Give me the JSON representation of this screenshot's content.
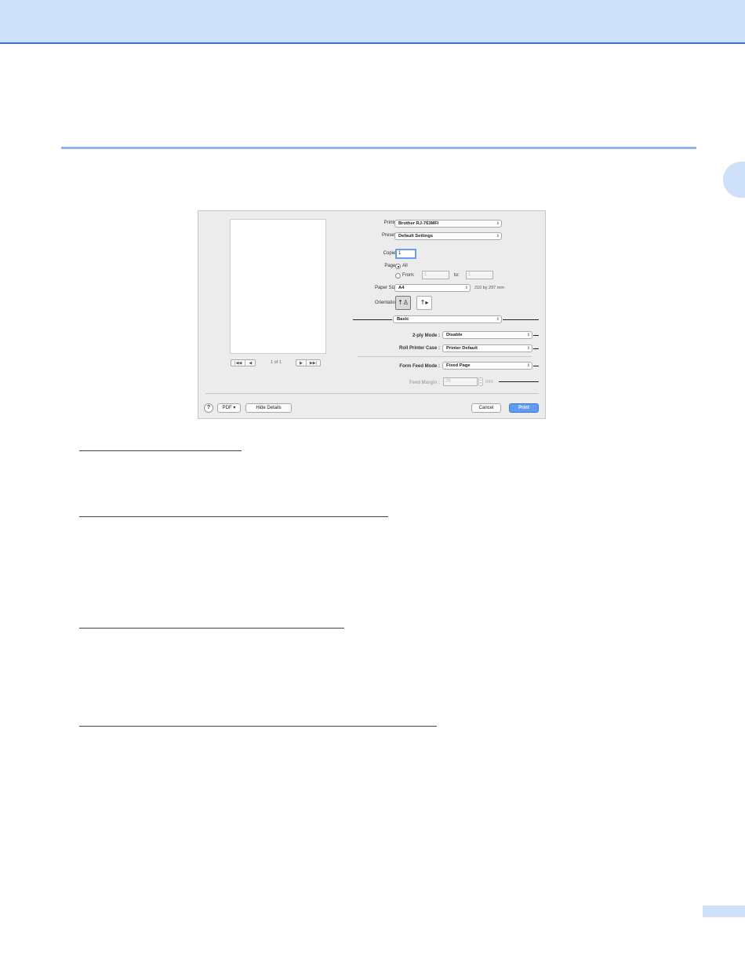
{
  "dialog": {
    "preview": {
      "page_counter": "1 of 1",
      "first_label": "|◀◀",
      "prev_label": "◀",
      "next_label": "▶",
      "last_label": "▶▶|"
    },
    "printer": {
      "label": "Printer:",
      "value": "Brother RJ-763MFi"
    },
    "presets": {
      "label": "Presets:",
      "value": "Default Settings"
    },
    "copies": {
      "label": "Copies:",
      "value": "1"
    },
    "pages": {
      "label": "Pages:",
      "all_label": "All",
      "from_label": "From:",
      "from_value": "1",
      "to_label": "to:",
      "to_value": "1",
      "selected": "All"
    },
    "paper_size": {
      "label": "Paper Size:",
      "value": "A4",
      "dimensions": "210 by 297 mm"
    },
    "orientation": {
      "label": "Orientation:",
      "selected": "portrait"
    },
    "panel_menu": {
      "value": "Basic"
    },
    "two_ply_mode": {
      "label": "2-ply Mode :",
      "value": "Disable"
    },
    "roll_printer_case": {
      "label": "Roll Printer Case :",
      "value": "Printer Default"
    },
    "form_feed_mode": {
      "label": "Form Feed Mode :",
      "value": "Fixed Page"
    },
    "feed_margin": {
      "label": "Feed Margin :",
      "value": "26",
      "unit": "mm",
      "enabled": false
    },
    "footer": {
      "help_label": "?",
      "pdf_label": "PDF ▾",
      "hide_details_label": "Hide Details",
      "cancel_label": "Cancel",
      "print_label": "Print"
    }
  },
  "colors": {
    "header_band": "#cfe0fb",
    "header_rule": "#3f6fc5",
    "section_rule": "#8fb3ee",
    "print_button": "#5f9bf2"
  }
}
